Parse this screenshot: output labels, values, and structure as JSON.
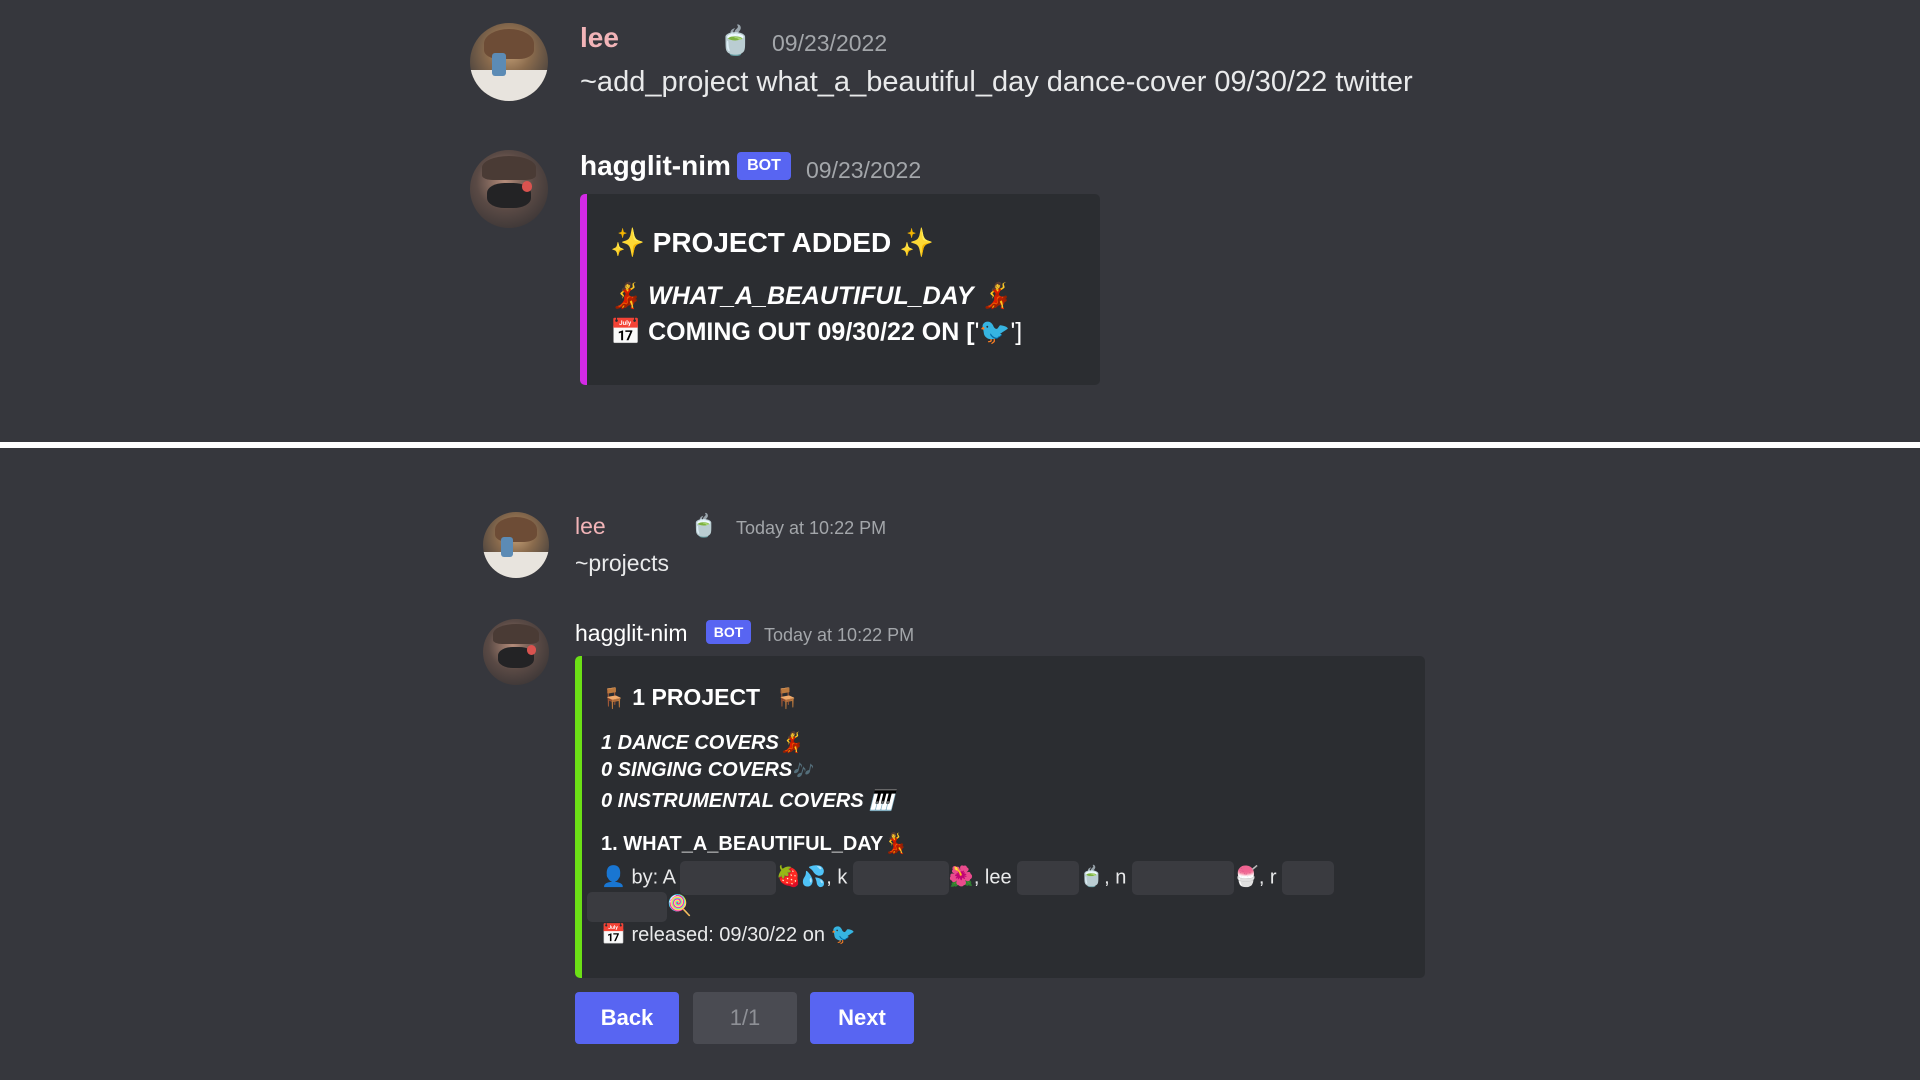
{
  "top": {
    "msg1": {
      "username": "lee",
      "status_emoji": "🍵",
      "timestamp": "09/23/2022",
      "text": "~add_project what_a_beautiful_day dance-cover 09/30/22 twitter"
    },
    "msg2": {
      "username": "hagglit-nim",
      "bot_tag": "BOT",
      "timestamp": "09/23/2022",
      "embed": {
        "accent": "#d42ae6",
        "title_emoji": "✨",
        "title": "PROJECT ADDED",
        "line1_emoji": "💃",
        "line1": "WHAT_A_BEAUTIFUL_DAY",
        "line2_emoji": "📅",
        "line2_prefix": "COMING OUT 09/30/22 ON [",
        "line2_q1": "'",
        "line2_twitter": "🐦",
        "line2_suffix": "']"
      }
    }
  },
  "bottom": {
    "msg1": {
      "username": "lee",
      "status_emoji": "🍵",
      "timestamp": "Today at 10:22 PM",
      "text": "~projects"
    },
    "msg2": {
      "username": "hagglit-nim",
      "bot_tag": "BOT",
      "timestamp": "Today at 10:22 PM",
      "embed": {
        "accent": "#6ce016",
        "title_emoji": "🪑",
        "title": "1 PROJECT",
        "dance": "1 DANCE COVERS",
        "dance_emoji": "💃",
        "singing": "0 SINGING COVERS",
        "singing_emoji": "🎶",
        "instrumental": "0 INSTRUMENTAL COVERS",
        "instrumental_emoji": "🎹",
        "item_title": "1. WHAT_A_BEAUTIFUL_DAY",
        "item_emoji": "💃",
        "by_emoji": "👤",
        "by_label": "by: A",
        "by_e1": "🍓💦",
        "by_k": ", k",
        "by_e2": "🌺",
        "by_lee": ", lee",
        "by_e3": "🍵",
        "by_n": ", n",
        "by_e4": "🍧",
        "by_r": ", r",
        "by_e5": "🍭",
        "released_emoji": "📅",
        "released": "released: 09/30/22 on",
        "released_platform": "🐦"
      },
      "buttons": {
        "back": "Back",
        "page": "1/1",
        "next": "Next"
      }
    }
  }
}
